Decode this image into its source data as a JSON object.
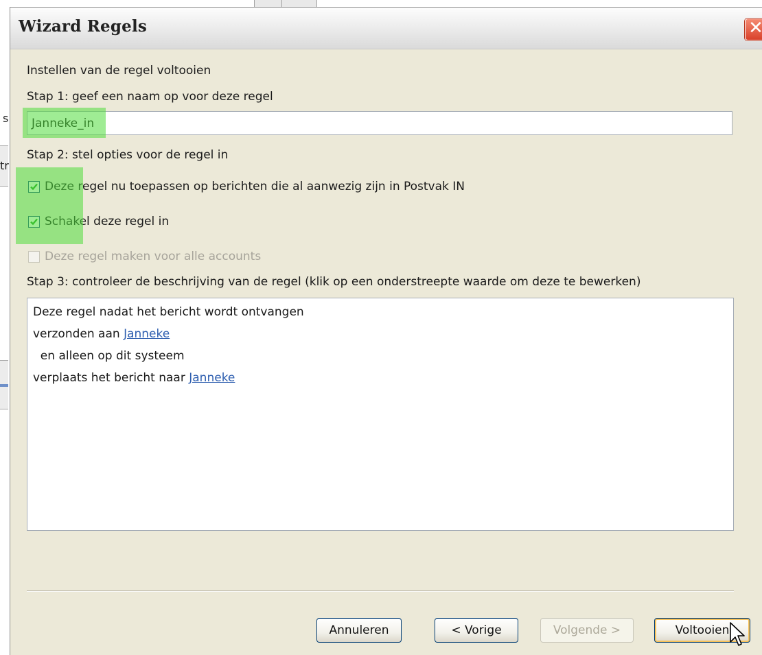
{
  "background": {
    "fragment_char_1": "s",
    "fragment_char_2": "tr"
  },
  "dialog": {
    "title": "Wizard Regels",
    "close_symbol": "✕"
  },
  "intro": "Instellen van de regel voltooien",
  "step1": {
    "label": "Stap 1: geef een naam op voor deze regel",
    "name_value": "Janneke_in"
  },
  "step2": {
    "label": "Stap 2: stel opties voor de regel in",
    "options": [
      {
        "label": "Deze regel nu toepassen op berichten die al aanwezig zijn in Postvak IN",
        "checked": true,
        "enabled": true
      },
      {
        "label": "Schakel deze regel in",
        "checked": true,
        "enabled": true
      },
      {
        "label": "Deze regel maken voor alle accounts",
        "checked": false,
        "enabled": false
      }
    ]
  },
  "step3": {
    "label": "Stap 3: controleer de beschrijving van de regel (klik op een onderstreepte waarde om deze te bewerken)",
    "lines": [
      {
        "text": "Deze regel nadat het bericht wordt ontvangen",
        "link": ""
      },
      {
        "text": "verzonden aan ",
        "link": "Janneke"
      },
      {
        "text": "  en alleen op dit systeem",
        "link": ""
      },
      {
        "text": "verplaats het bericht naar ",
        "link": "Janneke"
      }
    ]
  },
  "buttons": {
    "cancel": "Annuleren",
    "previous": "< Vorige",
    "next": "Volgende >",
    "finish": "Voltooien"
  },
  "colors": {
    "highlight": "#50dc3c",
    "dialog_bg": "#ece9d8",
    "close_red": "#d9412a",
    "link": "#2f5fb0",
    "checkmark": "#21a121"
  },
  "icons": {
    "close": "close-icon",
    "check": "checkmark-icon",
    "cursor": "mouse-pointer-icon"
  }
}
